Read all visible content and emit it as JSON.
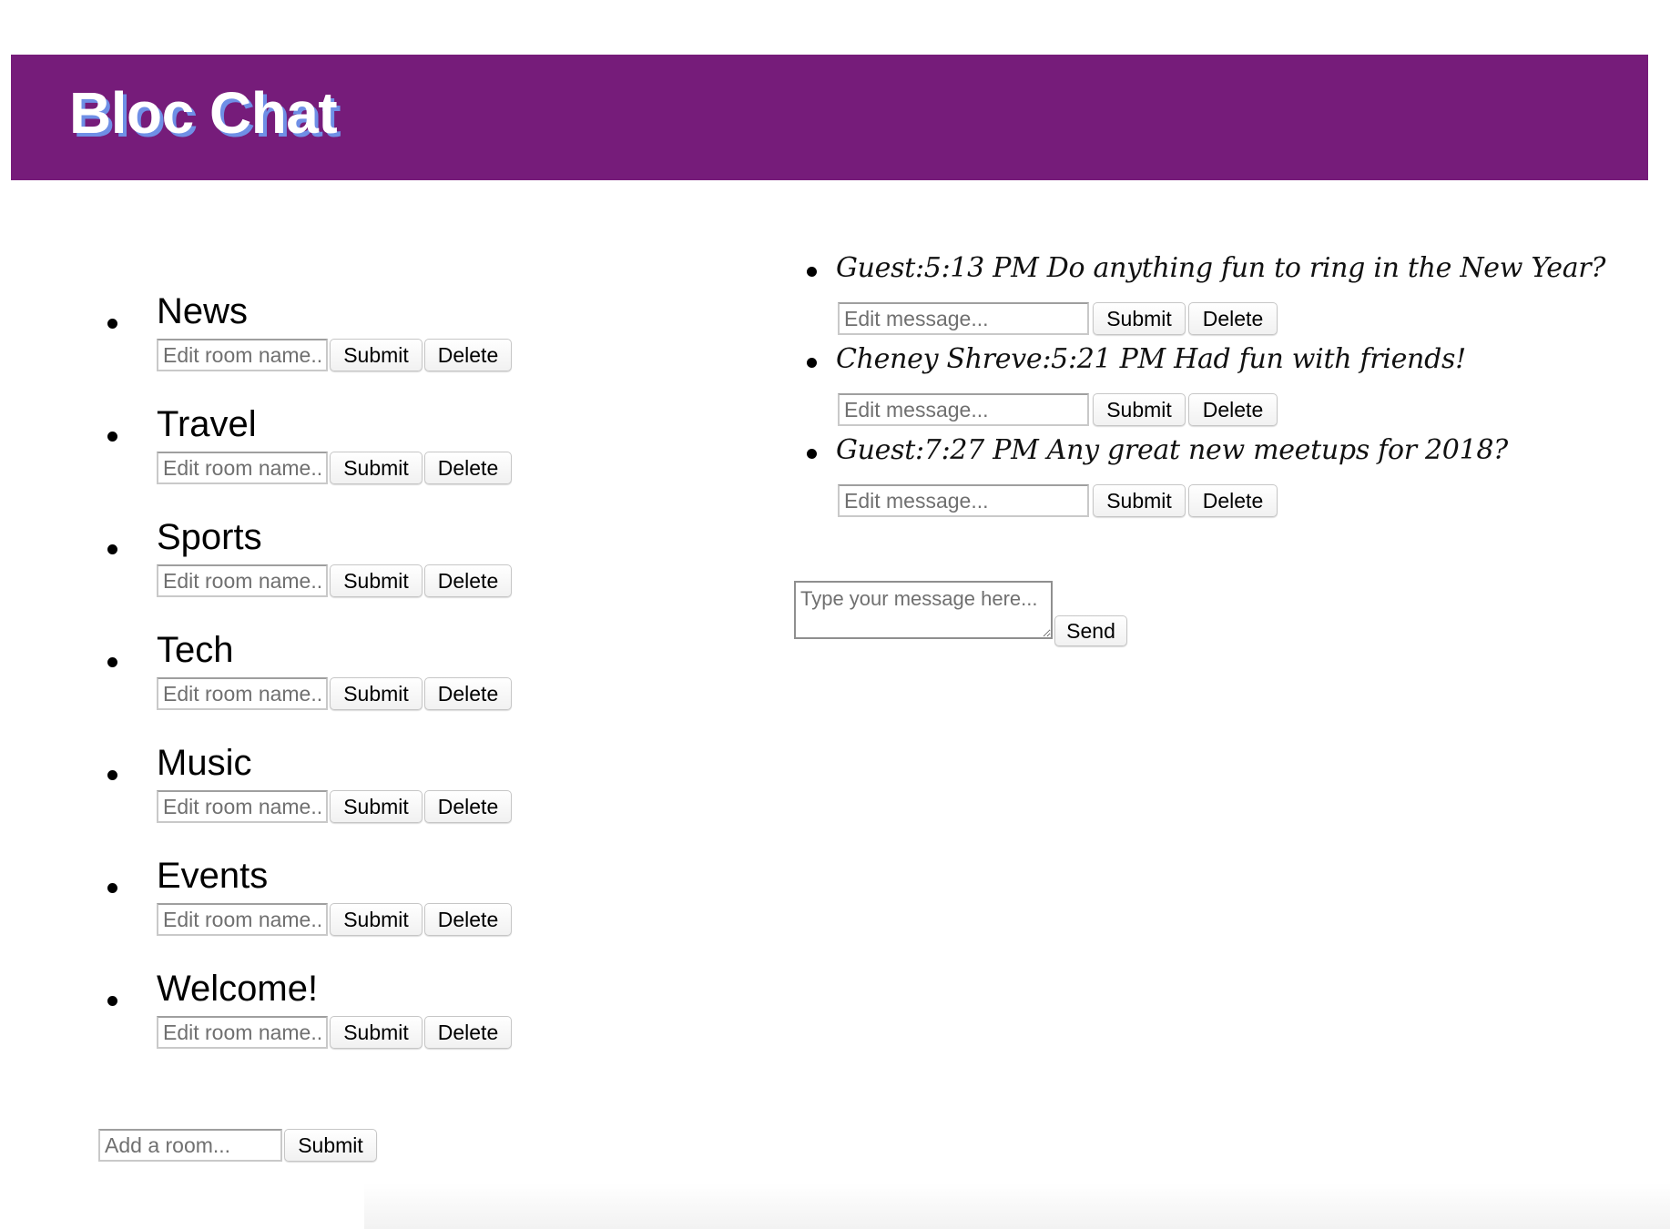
{
  "header": {
    "title": "Bloc Chat",
    "background_color": "#761c7a",
    "title_color": "#ffffff",
    "title_shadow_color": "#6f8fe6"
  },
  "rooms": {
    "items": [
      {
        "name": "News"
      },
      {
        "name": "Travel"
      },
      {
        "name": "Sports"
      },
      {
        "name": "Tech"
      },
      {
        "name": "Music"
      },
      {
        "name": "Events"
      },
      {
        "name": "Welcome!"
      }
    ],
    "edit_placeholder": "Edit room name...",
    "submit_label": "Submit",
    "delete_label": "Delete",
    "add_room": {
      "placeholder": "Add a room...",
      "submit_label": "Submit"
    }
  },
  "messages": {
    "items": [
      {
        "text": "Guest:5:13 PM Do anything fun to ring in the New Year?"
      },
      {
        "text": "Cheney Shreve:5:21 PM Had fun with friends!"
      },
      {
        "text": "Guest:7:27 PM Any great new meetups for 2018?"
      }
    ],
    "edit_placeholder": "Edit message...",
    "submit_label": "Submit",
    "delete_label": "Delete"
  },
  "composer": {
    "placeholder": "Type your message here...",
    "send_label": "Send"
  }
}
